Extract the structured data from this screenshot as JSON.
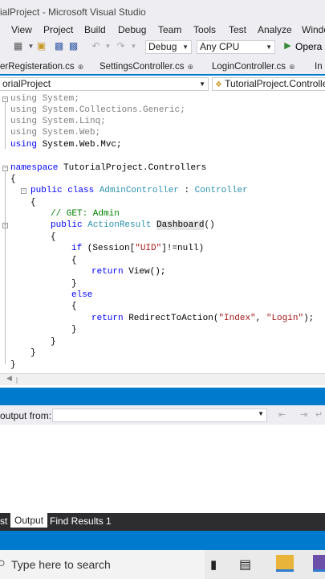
{
  "window": {
    "title": "ialProject - Microsoft Visual Studio"
  },
  "menu": [
    "View",
    "Project",
    "Build",
    "Debug",
    "Team",
    "Tools",
    "Test",
    "Analyze",
    "Windo"
  ],
  "toolbar": {
    "config": "Debug",
    "platform": "Any CPU",
    "run_label": "Opera I"
  },
  "tabs": [
    "erRegisteration.cs",
    "SettingsController.cs",
    "LoginController.cs",
    "In"
  ],
  "nav": {
    "project": "orialProject",
    "class": "TutorialProject.Controllers"
  },
  "code": {
    "l1": "using System;",
    "l2": "using System.Collections.Generic;",
    "l3": "using System.Linq;",
    "l4": "using System.Web;",
    "l5_kw": "using",
    "l5_rest": " System.Web.Mvc;",
    "ns_kw": "namespace",
    "ns_name": " TutorialProject.Controllers",
    "ob": "{",
    "cb": "}",
    "cls_kw": "public class",
    "cls_name": "AdminController",
    "cls_sep": " : ",
    "cls_base": "Controller",
    "comment": "// GET: Admin",
    "m_kw": "public",
    "m_type": "ActionResult",
    "m_name": "Dashboard",
    "m_parens": "()",
    "if_kw": "if",
    "if_a": " (Session[",
    "if_str": "\"UID\"",
    "if_b": "]!=null)",
    "ret_kw": "return",
    "ret1": " View();",
    "else_kw": "else",
    "ret2_a": " RedirectToAction(",
    "ret2_s1": "\"Index\"",
    "ret2_c": ", ",
    "ret2_s2": "\"Login\"",
    "ret2_e": ");"
  },
  "output": {
    "label": "output from:"
  },
  "bottom_tabs": [
    "st",
    "Output",
    "Find Results 1"
  ],
  "taskbar": {
    "search_placeholder": "Type here to search"
  },
  "colors": {
    "accent": "#007acc",
    "keyword": "#0000ff",
    "type": "#2b91af",
    "comment": "#008000",
    "string": "#a31515"
  }
}
